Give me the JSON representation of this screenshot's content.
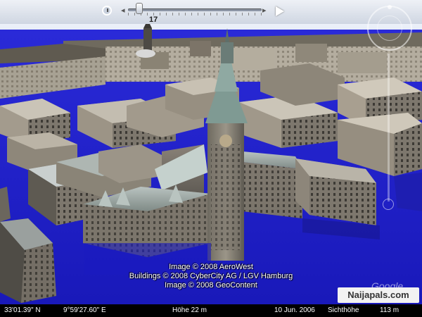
{
  "time_slider": {
    "value_label": "17",
    "left_arrow": "◂",
    "right_arrow": "▸"
  },
  "credits": {
    "line1": "Image © 2008 AeroWest",
    "line2": "Buildings © 2008 CyberCity AG / LGV Hamburg",
    "line3": "Image © 2008 GeoContent"
  },
  "watermark": "Naijapals.com",
  "logo": "Google",
  "status": {
    "latitude": "33'01.39\"  N",
    "longitude": "9°59'27.60\" E",
    "elevation": "Höhe  22 m",
    "imagery_date": "10 Jun. 2006",
    "eye_alt_label": "Sichthöhe",
    "eye_alt_value": "113 m"
  },
  "colors": {
    "water": "#1f1fd0",
    "water_dark": "#14149a",
    "sky": "#e4eaf6"
  }
}
